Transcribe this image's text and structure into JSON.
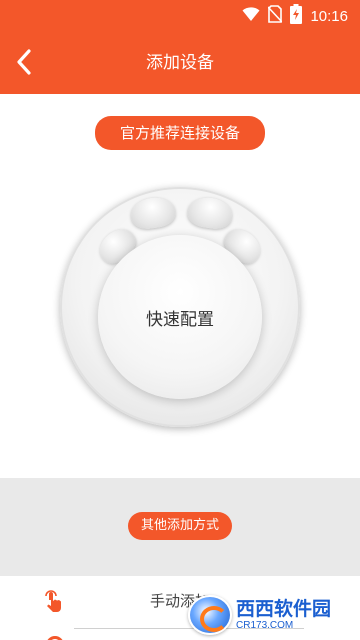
{
  "status_bar": {
    "time": "10:16",
    "icons": [
      "wifi-icon",
      "no-sim-icon",
      "battery-charging-icon"
    ]
  },
  "app_bar": {
    "title": "添加设备",
    "back_icon": "chevron-left-icon"
  },
  "main": {
    "recommend_button_label": "官方推荐连接设备",
    "quick_config_label": "快速配置"
  },
  "other_section": {
    "other_methods_button_label": "其他添加方式"
  },
  "list": {
    "items": [
      {
        "label": "手动添加",
        "icon": "tap-hand-icon"
      },
      {
        "label": "",
        "icon": "ring-icon"
      }
    ]
  },
  "watermark": {
    "main_text": "西西软件园",
    "sub_text": "CR173.COM"
  },
  "colors": {
    "accent": "#f3572a",
    "section_bg": "#e9e9e9"
  }
}
